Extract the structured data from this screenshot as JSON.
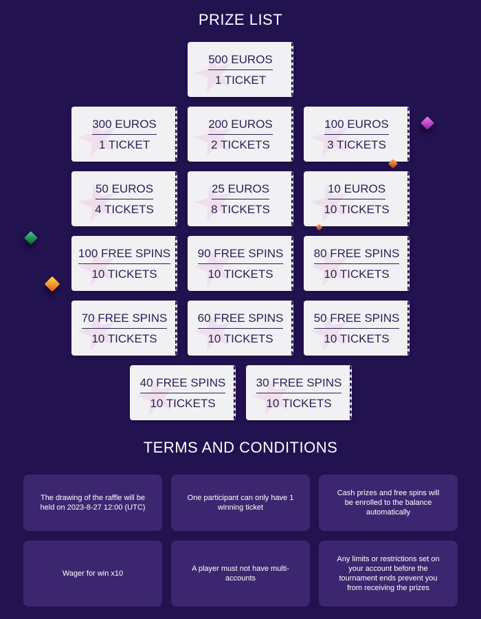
{
  "prize_section": {
    "title": "PRIZE LIST",
    "prizes": [
      {
        "amount": "500 EUROS",
        "tickets": "1 TICKET"
      },
      {
        "amount": "300 EUROS",
        "tickets": "1 TICKET"
      },
      {
        "amount": "200 EUROS",
        "tickets": "2 TICKETS"
      },
      {
        "amount": "100 EUROS",
        "tickets": "3 TICKETS"
      },
      {
        "amount": "50 EUROS",
        "tickets": "4 TICKETS"
      },
      {
        "amount": "25 EUROS",
        "tickets": "8 TICKETS"
      },
      {
        "amount": "10 EUROS",
        "tickets": "10 TICKETS"
      },
      {
        "amount": "100 FREE SPINS",
        "tickets": "10 TICKETS"
      },
      {
        "amount": "90 FREE SPINS",
        "tickets": "10 TICKETS"
      },
      {
        "amount": "80 FREE SPINS",
        "tickets": "10 TICKETS"
      },
      {
        "amount": "70 FREE SPINS",
        "tickets": "10 TICKETS"
      },
      {
        "amount": "60 FREE SPINS",
        "tickets": "10 TICKETS"
      },
      {
        "amount": "50 FREE SPINS",
        "tickets": "10 TICKETS"
      },
      {
        "amount": "40 FREE SPINS",
        "tickets": "10 TICKETS"
      },
      {
        "amount": "30 FREE SPINS",
        "tickets": "10 TICKETS"
      }
    ]
  },
  "terms_section": {
    "title": "TERMS AND CONDITIONS",
    "items": [
      "The drawing of the raffle will be held on 2023-8-27 12:00 (UTC)",
      "One participant can only have 1 winning ticket",
      "Cash prizes and free spins will be enrolled to the balance automatically",
      "Wager for win x10",
      "A player must not have multi-accounts",
      "Any limits or restrictions set on your account before the tournament ends prevent you from receiving the prizes"
    ]
  },
  "decorations": {
    "gem_colors": [
      "#c43ad6",
      "#e0571e",
      "#1f7a55",
      "#f0a516",
      "#d8461c"
    ]
  }
}
